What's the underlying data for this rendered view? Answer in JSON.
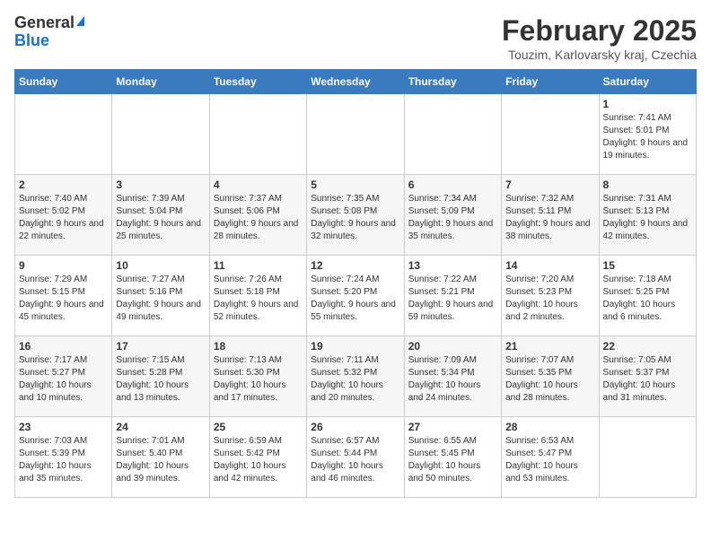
{
  "logo": {
    "general": "General",
    "blue": "Blue"
  },
  "title": "February 2025",
  "location": "Touzim, Karlovarsky kraj, Czechia",
  "days_of_week": [
    "Sunday",
    "Monday",
    "Tuesday",
    "Wednesday",
    "Thursday",
    "Friday",
    "Saturday"
  ],
  "weeks": [
    [
      {
        "day": "",
        "info": ""
      },
      {
        "day": "",
        "info": ""
      },
      {
        "day": "",
        "info": ""
      },
      {
        "day": "",
        "info": ""
      },
      {
        "day": "",
        "info": ""
      },
      {
        "day": "",
        "info": ""
      },
      {
        "day": "1",
        "info": "Sunrise: 7:41 AM\nSunset: 5:01 PM\nDaylight: 9 hours and 19 minutes."
      }
    ],
    [
      {
        "day": "2",
        "info": "Sunrise: 7:40 AM\nSunset: 5:02 PM\nDaylight: 9 hours and 22 minutes."
      },
      {
        "day": "3",
        "info": "Sunrise: 7:39 AM\nSunset: 5:04 PM\nDaylight: 9 hours and 25 minutes."
      },
      {
        "day": "4",
        "info": "Sunrise: 7:37 AM\nSunset: 5:06 PM\nDaylight: 9 hours and 28 minutes."
      },
      {
        "day": "5",
        "info": "Sunrise: 7:35 AM\nSunset: 5:08 PM\nDaylight: 9 hours and 32 minutes."
      },
      {
        "day": "6",
        "info": "Sunrise: 7:34 AM\nSunset: 5:09 PM\nDaylight: 9 hours and 35 minutes."
      },
      {
        "day": "7",
        "info": "Sunrise: 7:32 AM\nSunset: 5:11 PM\nDaylight: 9 hours and 38 minutes."
      },
      {
        "day": "8",
        "info": "Sunrise: 7:31 AM\nSunset: 5:13 PM\nDaylight: 9 hours and 42 minutes."
      }
    ],
    [
      {
        "day": "9",
        "info": "Sunrise: 7:29 AM\nSunset: 5:15 PM\nDaylight: 9 hours and 45 minutes."
      },
      {
        "day": "10",
        "info": "Sunrise: 7:27 AM\nSunset: 5:16 PM\nDaylight: 9 hours and 49 minutes."
      },
      {
        "day": "11",
        "info": "Sunrise: 7:26 AM\nSunset: 5:18 PM\nDaylight: 9 hours and 52 minutes."
      },
      {
        "day": "12",
        "info": "Sunrise: 7:24 AM\nSunset: 5:20 PM\nDaylight: 9 hours and 55 minutes."
      },
      {
        "day": "13",
        "info": "Sunrise: 7:22 AM\nSunset: 5:21 PM\nDaylight: 9 hours and 59 minutes."
      },
      {
        "day": "14",
        "info": "Sunrise: 7:20 AM\nSunset: 5:23 PM\nDaylight: 10 hours and 2 minutes."
      },
      {
        "day": "15",
        "info": "Sunrise: 7:18 AM\nSunset: 5:25 PM\nDaylight: 10 hours and 6 minutes."
      }
    ],
    [
      {
        "day": "16",
        "info": "Sunrise: 7:17 AM\nSunset: 5:27 PM\nDaylight: 10 hours and 10 minutes."
      },
      {
        "day": "17",
        "info": "Sunrise: 7:15 AM\nSunset: 5:28 PM\nDaylight: 10 hours and 13 minutes."
      },
      {
        "day": "18",
        "info": "Sunrise: 7:13 AM\nSunset: 5:30 PM\nDaylight: 10 hours and 17 minutes."
      },
      {
        "day": "19",
        "info": "Sunrise: 7:11 AM\nSunset: 5:32 PM\nDaylight: 10 hours and 20 minutes."
      },
      {
        "day": "20",
        "info": "Sunrise: 7:09 AM\nSunset: 5:34 PM\nDaylight: 10 hours and 24 minutes."
      },
      {
        "day": "21",
        "info": "Sunrise: 7:07 AM\nSunset: 5:35 PM\nDaylight: 10 hours and 28 minutes."
      },
      {
        "day": "22",
        "info": "Sunrise: 7:05 AM\nSunset: 5:37 PM\nDaylight: 10 hours and 31 minutes."
      }
    ],
    [
      {
        "day": "23",
        "info": "Sunrise: 7:03 AM\nSunset: 5:39 PM\nDaylight: 10 hours and 35 minutes."
      },
      {
        "day": "24",
        "info": "Sunrise: 7:01 AM\nSunset: 5:40 PM\nDaylight: 10 hours and 39 minutes."
      },
      {
        "day": "25",
        "info": "Sunrise: 6:59 AM\nSunset: 5:42 PM\nDaylight: 10 hours and 42 minutes."
      },
      {
        "day": "26",
        "info": "Sunrise: 6:57 AM\nSunset: 5:44 PM\nDaylight: 10 hours and 46 minutes."
      },
      {
        "day": "27",
        "info": "Sunrise: 6:55 AM\nSunset: 5:45 PM\nDaylight: 10 hours and 50 minutes."
      },
      {
        "day": "28",
        "info": "Sunrise: 6:53 AM\nSunset: 5:47 PM\nDaylight: 10 hours and 53 minutes."
      },
      {
        "day": "",
        "info": ""
      }
    ]
  ]
}
